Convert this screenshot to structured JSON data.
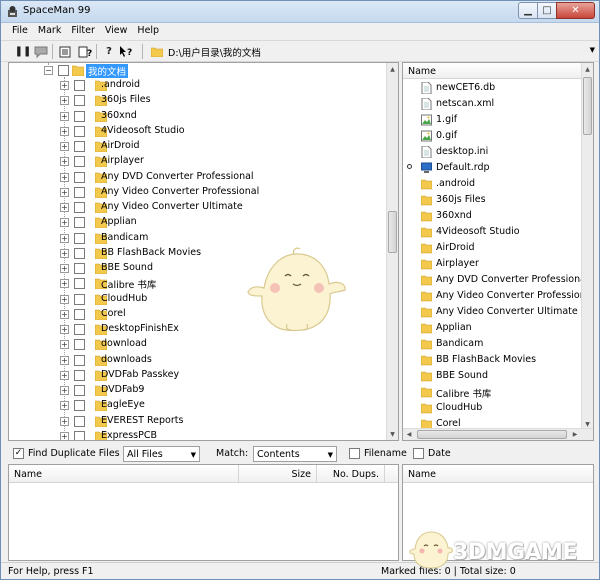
{
  "window": {
    "title": "SpaceMan 99"
  },
  "menu": [
    "File",
    "Mark",
    "Filter",
    "View",
    "Help"
  ],
  "toolbar": {
    "icons": [
      "pause-icon",
      "comment-icon",
      "list-icon",
      "help-page-icon",
      "help-icon",
      "whats-this-icon"
    ],
    "path": "D:\\用户目录\\我的文档"
  },
  "tree": {
    "root": "我的文档",
    "items": [
      ".android",
      "360js Files",
      "360xnd",
      "4Videosoft Studio",
      "AirDroid",
      "Airplayer",
      "Any DVD Converter Professional",
      "Any Video Converter Professional",
      "Any Video Converter Ultimate",
      "Applian",
      "Bandicam",
      "BB FlashBack Movies",
      "BBE Sound",
      "Calibre 书库",
      "CloudHub",
      "Corel",
      "DesktopFinishEx",
      "download",
      "downloads",
      "DVDFab Passkey",
      "DVDFab9",
      "EagleEye",
      "EVEREST Reports",
      "ExpressPCB"
    ]
  },
  "files": {
    "header": "Name",
    "items": [
      {
        "name": "newCET6.db",
        "type": "file"
      },
      {
        "name": "netscan.xml",
        "type": "file"
      },
      {
        "name": "1.gif",
        "type": "image"
      },
      {
        "name": "0.gif",
        "type": "image"
      },
      {
        "name": "desktop.ini",
        "type": "file"
      },
      {
        "name": "Default.rdp",
        "type": "rdp"
      },
      {
        "name": ".android",
        "type": "folder"
      },
      {
        "name": "360js Files",
        "type": "folder"
      },
      {
        "name": "360xnd",
        "type": "folder"
      },
      {
        "name": "4Videosoft Studio",
        "type": "folder"
      },
      {
        "name": "AirDroid",
        "type": "folder"
      },
      {
        "name": "Airplayer",
        "type": "folder"
      },
      {
        "name": "Any DVD Converter Professional",
        "type": "folder"
      },
      {
        "name": "Any Video Converter Professional",
        "type": "folder"
      },
      {
        "name": "Any Video Converter Ultimate",
        "type": "folder"
      },
      {
        "name": "Applian",
        "type": "folder"
      },
      {
        "name": "Bandicam",
        "type": "folder"
      },
      {
        "name": "BB FlashBack Movies",
        "type": "folder"
      },
      {
        "name": "BBE Sound",
        "type": "folder"
      },
      {
        "name": "Calibre 书库",
        "type": "folder"
      },
      {
        "name": "CloudHub",
        "type": "folder"
      },
      {
        "name": "Corel",
        "type": "folder"
      }
    ]
  },
  "find": {
    "find_duplicates_label": "Find Duplicate Files",
    "filter_value": "All Files",
    "match_label": "Match:",
    "match_value": "Contents",
    "filename_label": "Filename",
    "date_label": "Date"
  },
  "duplicates": {
    "columns": [
      "Name",
      "Size",
      "No. Dups."
    ],
    "right_header": "Name"
  },
  "status": {
    "left": "For Help, press F1",
    "right": "Marked files: 0 | Total size: 0"
  },
  "watermark": {
    "text": "3DMGAME"
  },
  "colors": {
    "selection": "#3399ff",
    "folder": "#f2c94c",
    "close": "#c9463a"
  }
}
